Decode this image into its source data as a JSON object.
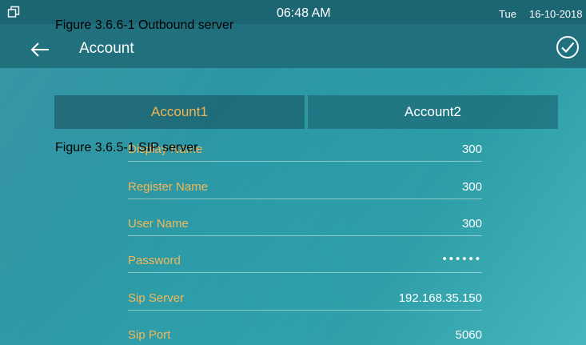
{
  "status_bar": {
    "time": "06:48 AM",
    "day": "Tue",
    "date": "16-10-2018"
  },
  "captions": {
    "top": "Figure 3.6.6-1 Outbound server",
    "middle": "Figure 3.6.5-1 SIP server"
  },
  "header": {
    "title": "Account"
  },
  "tabs": [
    {
      "label": "Account1",
      "selected": true
    },
    {
      "label": "Account2",
      "selected": false
    }
  ],
  "form": {
    "fields": [
      {
        "label": "Display Name",
        "value": "300"
      },
      {
        "label": "Register Name",
        "value": "300"
      },
      {
        "label": "User Name",
        "value": "300"
      },
      {
        "label": "Password",
        "value": "••••••"
      },
      {
        "label": "Sip Server",
        "value": "192.168.35.150"
      },
      {
        "label": "Sip Port",
        "value": "5060"
      }
    ]
  },
  "colors": {
    "accent_label": "#f4b757",
    "header_bar": "#20707e",
    "background": "#2b96a3"
  },
  "icons": {
    "window": "window-restore-icon",
    "back": "arrow-left-icon",
    "confirm": "check-circle-icon"
  }
}
